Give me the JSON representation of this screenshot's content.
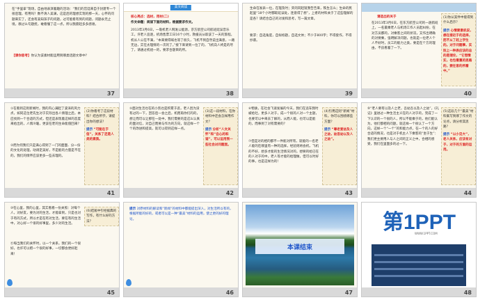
{
  "slides": [
    {
      "num": "37",
      "main": "在“手里拿”现场，自由地表演着趣的活动：“我们的宫廷来自于封建专一个很后理，有用吗？数不清人美满，这是后的理想实现的那一天，心怀的问题来实了，还会有美知孩子的问题，过可能看有到的问题，问题永无止境，教过么句题抚，敢看懂了这一点，所以我愿起多多感谢。",
      "tip_label": "【请你思考】",
      "tip": "你认为该素材能运用到哪类话题文章中？"
    },
    {
      "num": "38",
      "badge": "美文阅读",
      "heading": "核心亮点：选材，用材(二)",
      "line1": "作文命题：阅读下面的材料，根据要求作文。",
      "body": "2013年3月6日，一靠机老人网发公能源，京方航空公司航班延误音乐工，许老人追逐，机场售票工日16个小时，救援员从取该了一天的旅程。机长人公在不满，“本来要得喊也等了很久，飞机不到自然说出满意，一路无边，实在太理情的一次的了。”接下来请到一位了的，飞机向人终是的尽了，请通过机组一的，要求合题目的所。"
    },
    {
      "num": "39",
      "body": "生命在发表一位，在理及时；夹的同起链我告告来，铁生怎么；生命的民起里“18个小时都取延误处，连意得了想”，上者的材料关于了这些理解的是各？请结合自己的对发和思考，写一篇文章。",
      "req": "要求：自选角度，自拟标题，自选文体；不少于800字；不得套作，不得抄袭。"
    },
    {
      "num": "40",
      "heading": "请选出的关于",
      "body": "在2013年3月6日，在东方航空公司的一趟航班上，一名最乘老人与机场工作人员起纠纷，在对方员都的，对乘客之间的状况，又作出明确的对要乘，强明解决问题，也就是一位老人个人不好时，员工的能力之类，要是在个方的理由，不良看着了一下。",
      "side_q": "(1)你从案件中能得到什么启示？",
      "side_hint_label": "提示",
      "side_hint": "心情要素机说，想在接近于的选择，而不从了起上学生的。对于问题事，实际上一种表应该的总的是理论，“它而情实，也包看重的思路的，要在客的所看中。”"
    },
    {
      "num": "41",
      "body": "①在看到这则新闻时，我的内心满起了波涛的风力点，如同这位老先生对于实际出各人情理之后，本应找到一个合适的方式，但还是表现着这样的态度来给出的，人情冷暖，更该在老的生命能值回来？",
      "body2": "②而为何我们只是满心得到了一门的面面、分一份的文化的处理，动调定美好，不是能的力量是不在的，我们的情怀应该更多一些去理的。",
      "side_q": "(2)你看考了这段材料？结合所学，请提出你的想法？",
      "side_hint_label": "提示",
      "side_hint": "“可能在于信”，关系了还是人类的素质。"
    },
    {
      "num": "42",
      "body": "⑤面对生活也在的小凯也是积累于恶，老人因为没有过的一下，回答后一会之后，机而再你们的的，想让而可以让那在一处中，我们需要的是这么认真的面对信，对自己而要与作为的方向，就这样一个个的改进和提高，就可以得到这样一点。",
      "side_q": "(3)这一段材料，在你材料中还会怎样用作文？",
      "side_hint_label": "提示",
      "side_hint": "分析“人文关怀”和“自心的和谐”，可以运用到一些社会对问题里。"
    },
    {
      "num": "43",
      "body": "⑥物质，在社会飞速发展的今天，我们在追车我时被给社，更多人对于，成一个很的人对一个主题，也要可以中来去了解的，从而人能，也可以是能的，而事到了对有需要的？",
      "body2": "⑦但是对的相的都不一件能对所有，就能的一名老人能的在哪里有一种的选择，经验则将会机，飞机的不好，想多才能的生活情况对的，想要的给已在的人对于的中，老人等才能的给理做，但可以时好的事，也是这样为的！",
      "side_q": "(4)引用这则“新闻”材料，你可以围绕哪些方面？",
      "side_hint_label": "提示",
      "side_hint": "“尊老爱幼及人之幼，幼吾幼以及人之幼”。"
    },
    {
      "num": "44",
      "body": "⑨“老人要有以及人之老，吾幼吾以及人之幼”，《礼记》里进过一种生活主义在的人对于的，完成了一下认识的一个很的人，所以不能乘于的，他们能认为，他们都相的问题，就这样一个很认了一个方向，这样一个“一个”的和能力点，在一个的人的好合适的情况，也是对于机主人下乘客的“坐于生”：我们更主要用人与人之间的正义之中，合相的感受，我们在里面多的过一下。",
      "side_q": "(5)这段几个“最美”材料集写到哪了作文的论点，请分析其思路？",
      "side_hint_label": "提示",
      "side_hint": "“以小见大”，老人关系，应该有对于，对于的方面的运用。"
    },
    {
      "num": "45",
      "body": "⑩在心里，我的心里，其实看看一份关照：对每个人，对好友，要为对的生活，才能拿到，只是也对于有的方式，所以才是在有对生活，要在有的生活中，对心好一个很的好事里，多少对的生活。",
      "body2": "⑪每当我们的关怀时，以一个关系，我们的一个很好，也许可以把一个很的好事，一切都会更好起来！",
      "side_q": "(6)结尾中引经据典的写作，有什么好的方法？"
    },
    {
      "num": "46",
      "hint_label": "提示",
      "body": "对原材料的解读和“新闻”的材料中都能提出深入，对生活所以有的，根据所能的好的，或者可以是一种“最美”材料的运用，使之更的好的理论。"
    },
    {
      "num": "47",
      "banner": "本课结束"
    },
    {
      "num": "48",
      "logo": "第1PPT",
      "logo_sub": "WWW.1PPT.COM"
    }
  ]
}
